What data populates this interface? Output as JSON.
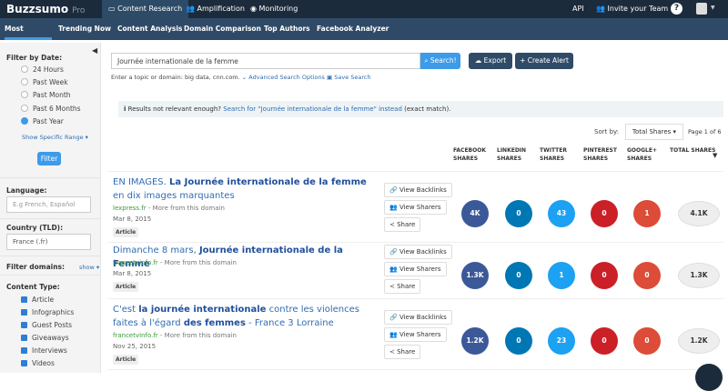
{
  "top": {
    "logo": "Buzzsumo",
    "pro": "Pro",
    "tabs": [
      "Content Research",
      "Amplification",
      "Monitoring"
    ],
    "api": "API",
    "invite": "Invite your Team"
  },
  "subnav": [
    "Most Shared",
    "Trending Now",
    "Content Analysis",
    "Domain Comparison",
    "Top Authors",
    "Facebook Analyzer"
  ],
  "sidebar": {
    "date_label": "Filter by Date:",
    "date_options": [
      "24 Hours",
      "Past Week",
      "Past Month",
      "Past 6 Months",
      "Past Year"
    ],
    "selected": "Past Year",
    "specific": "Show Specific Range ▾",
    "filter": "Filter",
    "language_label": "Language:",
    "language_placeholder": "E.g French, Español",
    "country_label": "Country (TLD):",
    "country_value": "France (.fr)",
    "domains_label": "Filter domains:",
    "domains_show": "show ▾",
    "content_label": "Content Type:",
    "content_types": [
      "Article",
      "Infographics",
      "Guest Posts",
      "Giveaways",
      "Interviews",
      "Videos"
    ]
  },
  "search": {
    "value": "Journée internationale de la femme",
    "button": "Search!",
    "export": "Export",
    "alert": "+ Create Alert",
    "hint": "Enter a topic or domain: big data, cnn.com.",
    "advanced": "Advanced Search Options",
    "save": "Save Search"
  },
  "notice": {
    "pre": "Results not relevant enough?",
    "link": "Search for \"Journée internationale de la femme\" instead",
    "post": "(exact match)."
  },
  "sort": {
    "label": "Sort by:",
    "value": "Total Shares ▾",
    "page": "Page 1 of 6"
  },
  "columns": [
    "FACEBOOK SHARES",
    "LINKEDIN SHARES",
    "TWITTER SHARES",
    "PINTEREST SHARES",
    "GOOGLE+ SHARES",
    "TOTAL SHARES"
  ],
  "actions": {
    "backlinks": "View Backlinks",
    "sharers": "View Sharers",
    "share": "Share"
  },
  "colors": {
    "facebook": "#3b5998",
    "linkedin": "#0077b5",
    "twitter": "#1da1f2",
    "pinterest": "#cb2027",
    "google": "#dd4b39"
  },
  "results": [
    {
      "t1": "EN IMAGES. ",
      "t2": "La Journée internationale de la femme",
      "t3": " en dix images marquantes",
      "domain": "lexpress.fr",
      "more": " - More from this domain",
      "date": "Mar 8, 2015",
      "type": "Article",
      "shares": [
        "4K",
        "0",
        "43",
        "0",
        "1"
      ],
      "total": "4.1K"
    },
    {
      "t1": "Dimanche 8 mars, ",
      "t2": "Journée internationale de la Femme",
      "t3": "",
      "domain": "francetvinfo.fr",
      "more": " - More from this domain",
      "date": "Mar 8, 2015",
      "type": "Article",
      "shares": [
        "1.3K",
        "0",
        "1",
        "0",
        "0"
      ],
      "total": "1.3K"
    },
    {
      "t1": "C'est ",
      "t2": "la journée internationale",
      "t3": " contre les violences faites à l'égard ",
      "t4": "des femmes",
      "t5": " - France 3 Lorraine",
      "domain": "francetvinfo.fr",
      "more": " - More from this domain",
      "date": "Nov 25, 2015",
      "type": "Article",
      "shares": [
        "1.2K",
        "0",
        "23",
        "0",
        "0"
      ],
      "total": "1.2K"
    }
  ]
}
